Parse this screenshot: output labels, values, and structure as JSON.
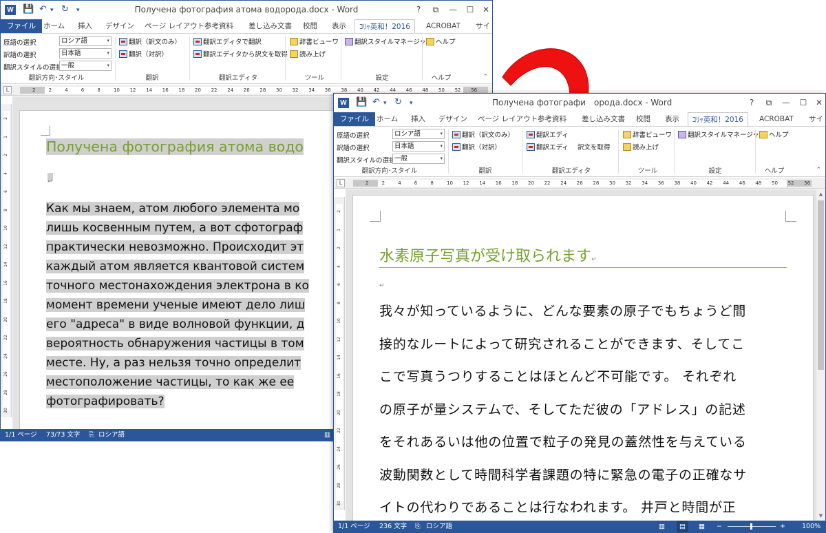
{
  "win1": {
    "title": "Получена фотография атома водорода.docx - Word",
    "window_buttons": [
      "?",
      "⧉",
      "—",
      "☐",
      "✕"
    ],
    "tabs": [
      "ファイル",
      "ホーム",
      "挿入",
      "デザイン",
      "ページ レイアウト",
      "参考資料",
      "差し込み文書",
      "校閲",
      "表示",
      "ｺﾘｬ英和！2016",
      "ACROBAT",
      "サイ"
    ],
    "ribbon": {
      "source_lang_label": "原語の選択",
      "source_lang_value": "ロシア語",
      "target_lang_label": "訳語の選択",
      "target_lang_value": "日本語",
      "style_label": "翻訳スタイルの選択",
      "style_value": "一般",
      "translate_only": "翻訳（訳文のみ）",
      "translate_pair": "翻訳（対訳）",
      "editor_translate": "翻訳エディタで翻訳",
      "editor_get": "翻訳エディタから訳文を取得",
      "dict_viewer": "辞書ビューワ",
      "read_aloud": "読み上げ",
      "style_manager": "翻訳スタイルマネージャ",
      "help": "ヘルプ",
      "group_direction": "翻訳方向･スタイル",
      "group_translate": "翻訳",
      "group_editor": "翻訳エディタ",
      "group_tools": "ツール",
      "group_settings": "設定",
      "group_help": "ヘルプ"
    },
    "ruler_numbers": [
      "2",
      "2",
      "4",
      "6",
      "8",
      "10",
      "12",
      "14",
      "16",
      "18",
      "20",
      "22",
      "24",
      "26",
      "28",
      "30",
      "32",
      "34",
      "36",
      "38",
      "40",
      "42",
      "44",
      "46",
      "48",
      "50",
      "52",
      "56"
    ],
    "vruler_numbers": [
      "2",
      "1",
      "2",
      "4",
      "6",
      "8",
      "10",
      "12",
      "14",
      "16",
      "18",
      "20",
      "22",
      "24",
      "26",
      "28",
      "30"
    ],
    "heading": "Получена фотография атома водо",
    "body_lines": [
      "Как мы знаем, атом любого элемента мо",
      "лишь косвенным путем, а вот сфотограф",
      "практически невозможно. Происходит эт",
      "каждый атом является квантовой систем",
      "точного местонахождения электрона в ко",
      "момент времени ученые имеют дело лиш",
      "его \"адреса\" в виде волновой функции, д",
      "вероятность обнаружения частицы в том",
      "месте. Ну, а раз нельзя точно определит",
      "местоположение частицы, то как же ее",
      "фотографировать?"
    ],
    "status_page": "1/1 ページ",
    "status_words": "73/73 文字",
    "status_lang": "ロシア語"
  },
  "win2": {
    "title": "Получена фотографи",
    "title_end": "орода.docx - Word",
    "window_buttons": [
      "?",
      "⧉",
      "—",
      "☐",
      "✕"
    ],
    "tabs": [
      "ファイル",
      "ホーム",
      "挿入",
      "デザイン",
      "ページ レイアウト",
      "参考資料",
      "差し込み文書",
      "校閲",
      "表示",
      "ｺﾘｬ英和！2016",
      "ACROBAT",
      "サイ"
    ],
    "ribbon": {
      "source_lang_label": "原語の選択",
      "source_lang_value": "ロシア語",
      "target_lang_label": "訳語の選択",
      "target_lang_value": "日本語",
      "style_label": "翻訳スタイルの選択",
      "style_value": "一般",
      "translate_only": "翻訳（訳文のみ）",
      "translate_pair": "翻訳（対訳）",
      "editor_translate": "翻訳エディ",
      "editor_get_a": "翻訳エディ",
      "editor_get_b": "訳文を取得",
      "dict_viewer": "辞書ビューワ",
      "read_aloud": "読み上げ",
      "style_manager": "翻訳スタイルマネージャ",
      "help": "ヘルプ",
      "group_direction": "翻訳方向･スタイル",
      "group_translate": "翻訳",
      "group_editor": "翻訳エディタ",
      "group_tools": "ツール",
      "group_settings": "設定",
      "group_help": "ヘルプ"
    },
    "ruler_numbers": [
      "2",
      "2",
      "4",
      "6",
      "8",
      "10",
      "12",
      "14",
      "16",
      "18",
      "20",
      "22",
      "24",
      "26",
      "28",
      "30",
      "32",
      "34",
      "36",
      "38",
      "40",
      "42",
      "44",
      "46",
      "48",
      "50",
      "52",
      "56"
    ],
    "vruler_numbers": [
      "2",
      "1",
      "2",
      "4",
      "6",
      "8",
      "10",
      "12",
      "14",
      "16",
      "18",
      "20",
      "22",
      "24",
      "26",
      "28",
      "30"
    ],
    "heading": "水素原子写真が受け取られます",
    "body_lines": [
      "我々が知っているように、どんな要素の原子でもちょうど間",
      "接的なルートによって研究されることができます、そしてこ",
      "こで写真うつりすることはほとんど不可能です。 それぞれ",
      "の原子が量システムで、そしてただ彼の「アドレス」の記述",
      "をそれあるいは他の位置で粒子の発見の蓋然性を与えている",
      "波動関数として時間科学者課題の特に緊急の電子の正確なサ",
      "イトの代わりであることは行なわれます。 井戸と時間が正"
    ],
    "status_page": "1/1 ページ",
    "status_words": "236 文字",
    "status_lang": "ロシア語",
    "zoom": "100%"
  },
  "colors": {
    "word_blue": "#2b579a",
    "heading_green": "#76a12a",
    "highlight_gray": "#cfcfcf",
    "arrow_red": "#ee1111"
  }
}
